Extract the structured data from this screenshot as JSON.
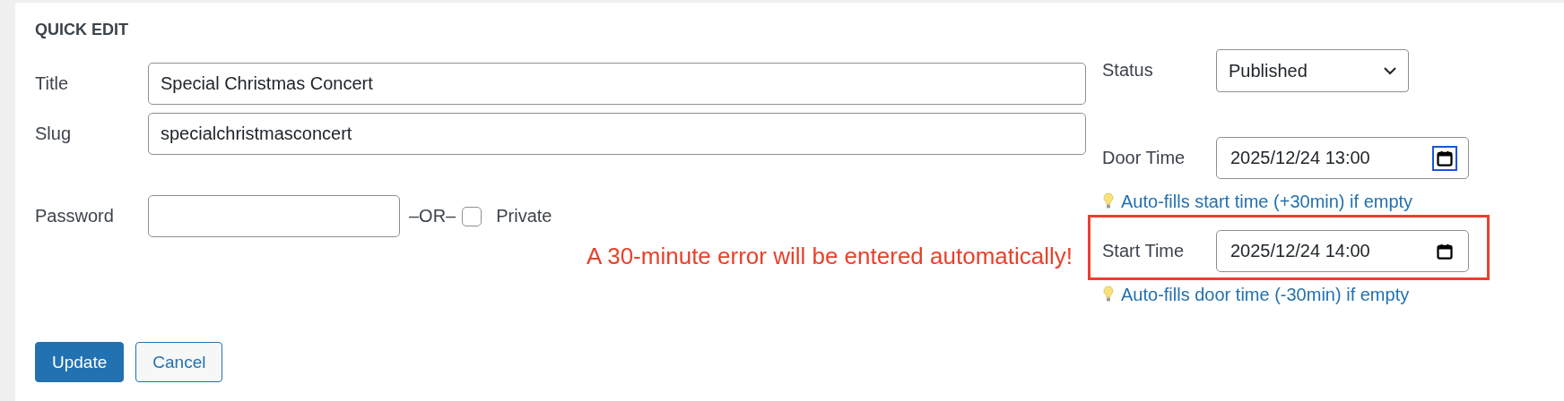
{
  "heading": "QUICK EDIT",
  "fields": [
    {
      "label": "Title",
      "value": "Special Christmas Concert"
    },
    {
      "label": "Slug",
      "value": "specialchristmasconcert"
    }
  ],
  "password": {
    "label": "Password",
    "separator": "–OR–",
    "private": {
      "label": "Private",
      "checked": false
    }
  },
  "annotation": "A 30-minute error will be entered automatically!",
  "status": {
    "label": "Status",
    "value": "Published"
  },
  "times": [
    {
      "label": "Door Time",
      "value": "2025/12/24 13:00",
      "picker_focused": true,
      "highlighted": false,
      "hint": "Auto-fills start time (+30min) if empty"
    },
    {
      "label": "Start Time",
      "value": "2025/12/24 14:00",
      "picker_focused": false,
      "highlighted": true,
      "hint": "Auto-fills door time (-30min) if empty"
    }
  ],
  "buttons": [
    {
      "label": "Update",
      "kind": "primary"
    },
    {
      "label": "Cancel",
      "kind": "secondary"
    }
  ]
}
